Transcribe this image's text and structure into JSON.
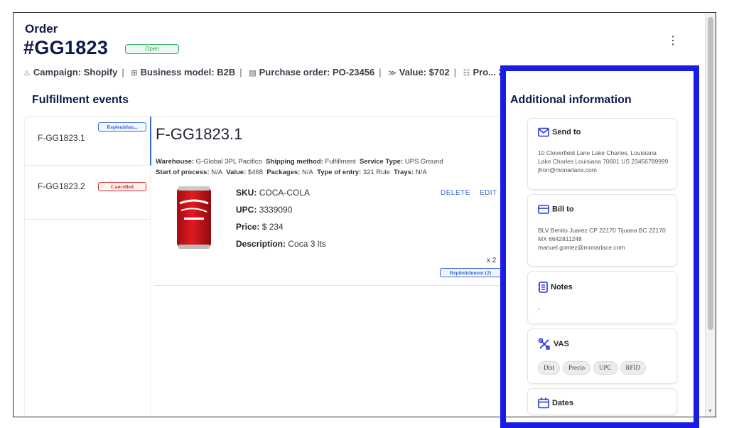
{
  "header": {
    "title_label": "Order",
    "order_id": "#GG1823",
    "status_badge": "Open",
    "more_icon": "vertical-dots-icon"
  },
  "meta": {
    "campaign": "Campaign: Shopify",
    "business_model": "Business model: B2B",
    "purchase_order": "Purchase order: PO-23456",
    "value": "Value: $702",
    "extra": "Pro... 2",
    "separator": "|"
  },
  "fulfillment": {
    "section_title": "Fulfillment events",
    "events": [
      {
        "name": "F-GG1823.1",
        "badge": "Replenishm...",
        "badge_color": "#3a68d8"
      },
      {
        "name": "F-GG1823.2",
        "badge": "Cancelled",
        "badge_color": "#d12c2c"
      }
    ],
    "detail": {
      "title": "F-GG1823.1",
      "warehouse_label": "Warehouse:",
      "warehouse": "G-Global 3PL Pacifico",
      "shipping_label": "Shipping method:",
      "shipping": "Fulfillment",
      "service_label": "Service Type:",
      "service": "UPS Ground",
      "start_label": "Start of process:",
      "start": "N/A",
      "value_label": "Value:",
      "value": "$468",
      "packages_label": "Packages:",
      "packages": "N/A",
      "entry_label": "Type of entry:",
      "entry": "321 Rule",
      "trays_label": "Trays:",
      "trays": "N/A",
      "product": {
        "sku_label": "SKU:",
        "sku": "COCA-COLA",
        "upc_label": "UPC:",
        "upc": "3339090",
        "price_label": "Price:",
        "price": "$ 234",
        "description_label": "Description:",
        "description": "Coca 3 lts",
        "delete_label": "DELETE",
        "edit_label": "EDIT",
        "quantity": "x 2",
        "type_badge": "Replenishment (2)"
      }
    }
  },
  "additional": {
    "title": "Additional information",
    "send_to": {
      "title": "Send to",
      "icon": "mail-icon",
      "text": "10 Cloverfield Lane Lake Charles, Louisiana Lake Charles Louisiana 70601 US 23456789999 jhon@monarlace.com"
    },
    "bill_to": {
      "title": "Bill to",
      "icon": "credit-card-icon",
      "text": "BLV Benito Juarez CP 22170 Tijuana BC 22170 MX 6642811248 manuel.gomez@monarlace.com"
    },
    "notes": {
      "title": "Notes",
      "icon": "notes-icon",
      "text": "-"
    },
    "vas": {
      "title": "VAS",
      "icon": "tools-icon",
      "chips": [
        "Dist",
        "Precio",
        "UPC",
        "RFID"
      ]
    },
    "dates": {
      "title": "Dates",
      "icon": "calendar-icon"
    }
  },
  "colors": {
    "brand_navy": "#0f1a4a",
    "link_blue": "#3a68d8",
    "open_green": "#2eae5a",
    "cancel_red": "#d12c2c",
    "highlight_blue": "#1b1be6"
  }
}
